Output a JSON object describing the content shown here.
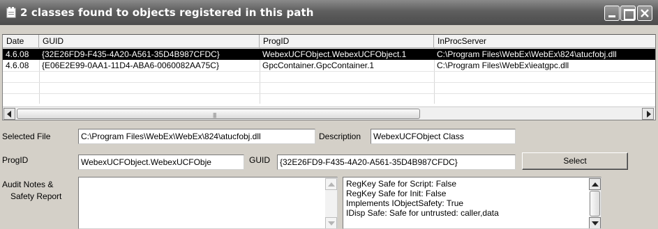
{
  "window": {
    "title": "2 classes found to objects registered in this path"
  },
  "listview": {
    "columns": [
      "Date",
      "GUID",
      "ProgID",
      "InProcServer"
    ],
    "rows": [
      [
        "4.6.08",
        "{32E26FD9-F435-4A20-A561-35D4B987CFDC}",
        "WebexUCFObject.WebexUCFObject.1",
        "C:\\Program Files\\WebEx\\WebEx\\824\\atucfobj.dll"
      ],
      [
        "4.6.08",
        "{E06E2E99-0AA1-11D4-ABA6-0060082AA75C}",
        "GpcContainer.GpcContainer.1",
        "C:\\Program Files\\WebEx\\ieatgpc.dll"
      ]
    ],
    "selected_row": 0
  },
  "form": {
    "selected_file_label": "Selected File",
    "selected_file_value": "C:\\Program Files\\WebEx\\WebEx\\824\\atucfobj.dll",
    "description_label": "Description",
    "description_value": "WebexUCFObject Class",
    "progid_label": "ProgID",
    "progid_value": "WebexUCFObject.WebexUCFObje",
    "guid_label": "GUID",
    "guid_value": "{32E26FD9-F435-4A20-A561-35D4B987CFDC}",
    "select_button": "Select",
    "audit_label_line1": "Audit Notes &",
    "audit_label_line2": "Safety Report",
    "audit_notes_value": "",
    "safety_lines": [
      "RegKey Safe for Script: False",
      "RegKey Safe for Init: False",
      "Implements IObjectSafety: True",
      "IDisp Safe:  Safe for untrusted: caller,data"
    ]
  },
  "icons": {
    "title": "app-window-icon",
    "minimize": "minimize-icon",
    "maximize": "maximize-icon",
    "close": "close-icon",
    "scroll_left": "arrow-left-icon",
    "scroll_right": "arrow-right-icon",
    "scroll_up": "arrow-up-icon",
    "scroll_down": "arrow-down-icon"
  },
  "colors": {
    "titlebar": "#5e5e5e",
    "selection": "#000000",
    "background": "#d4d0c8"
  }
}
